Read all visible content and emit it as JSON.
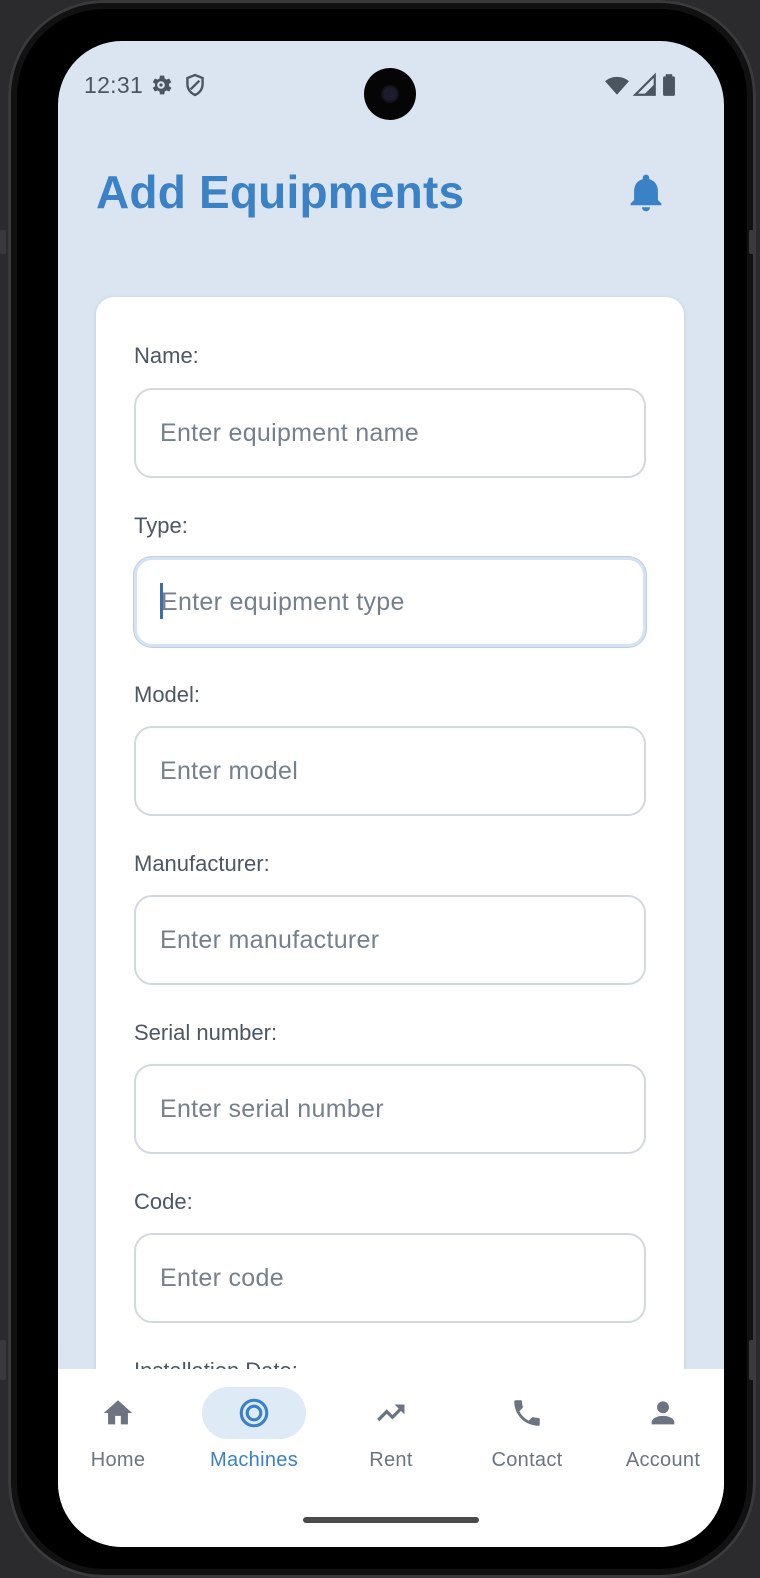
{
  "status_bar": {
    "time": "12:31",
    "icons": [
      "settings-icon",
      "shield-icon",
      "wifi-icon",
      "signal-icon",
      "battery-icon"
    ]
  },
  "header": {
    "title": "Add Equipments",
    "notification_icon": "bell-icon"
  },
  "form": {
    "fields": [
      {
        "label": "Name:",
        "placeholder": "Enter equipment name",
        "value": ""
      },
      {
        "label": "Type:",
        "placeholder": "Enter equipment type",
        "value": "",
        "focused": true
      },
      {
        "label": "Model:",
        "placeholder": "Enter model",
        "value": ""
      },
      {
        "label": "Manufacturer:",
        "placeholder": "Enter manufacturer",
        "value": ""
      },
      {
        "label": "Serial number:",
        "placeholder": "Enter serial number",
        "value": ""
      },
      {
        "label": "Code:",
        "placeholder": "Enter code",
        "value": ""
      },
      {
        "label": "Installation Date:"
      }
    ]
  },
  "bottom_nav": {
    "items": [
      {
        "label": "Home",
        "icon": "home-icon"
      },
      {
        "label": "Machines",
        "icon": "target-icon",
        "active": true
      },
      {
        "label": "Rent",
        "icon": "trending-up-icon"
      },
      {
        "label": "Contact",
        "icon": "phone-icon"
      },
      {
        "label": "Account",
        "icon": "person-icon"
      }
    ]
  },
  "colors": {
    "accent": "#3a82c5",
    "background": "#dbe5f1",
    "card": "#ffffff",
    "active_pill": "#deeaf6"
  }
}
